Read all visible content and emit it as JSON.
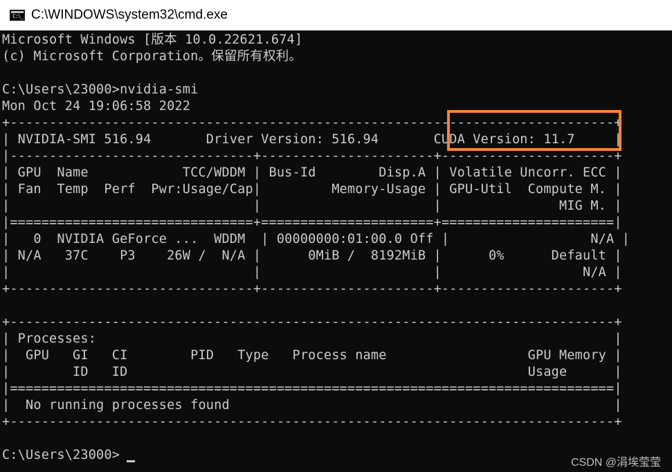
{
  "window": {
    "title": "C:\\WINDOWS\\system32\\cmd.exe",
    "icon": "cmd-icon",
    "icon_text": "C:\\_"
  },
  "console": {
    "background": "#0c0c0c",
    "foreground": "#cccccc",
    "lines": [
      "Microsoft Windows [版本 10.0.22621.674]",
      "(c) Microsoft Corporation。保留所有权利。",
      "",
      "C:\\Users\\23000>nvidia-smi",
      "Mon Oct 24 19:06:58 2022",
      "+-----------------------------------------------------------------------------+",
      "| NVIDIA-SMI 516.94       Driver Version: 516.94       CUDA Version: 11.7     |",
      "|-------------------------------+----------------------+----------------------+",
      "| GPU  Name            TCC/WDDM | Bus-Id        Disp.A | Volatile Uncorr. ECC |",
      "| Fan  Temp  Perf  Pwr:Usage/Cap|         Memory-Usage | GPU-Util  Compute M. |",
      "|                               |                      |               MIG M. |",
      "|===============================+======================+======================|",
      "|   0  NVIDIA GeForce ...  WDDM  | 00000000:01:00.0 Off |                  N/A |",
      "| N/A   37C    P3    26W /  N/A |      0MiB /  8192MiB |      0%      Default |",
      "|                               |                      |                  N/A |",
      "+-------------------------------+----------------------+----------------------+",
      "",
      "+-----------------------------------------------------------------------------+",
      "| Processes:                                                                  |",
      "|  GPU   GI   CI        PID   Type   Process name                  GPU Memory |",
      "|        ID   ID                                                   Usage      |",
      "|=============================================================================|",
      "|  No running processes found                                                 |",
      "+-----------------------------------------------------------------------------+",
      "",
      "C:\\Users\\23000>"
    ]
  },
  "highlight": {
    "color": "#f7843a",
    "target_text": "CUDA Version: 11.7"
  },
  "watermark": "CSDN @涓埃莹莹"
}
